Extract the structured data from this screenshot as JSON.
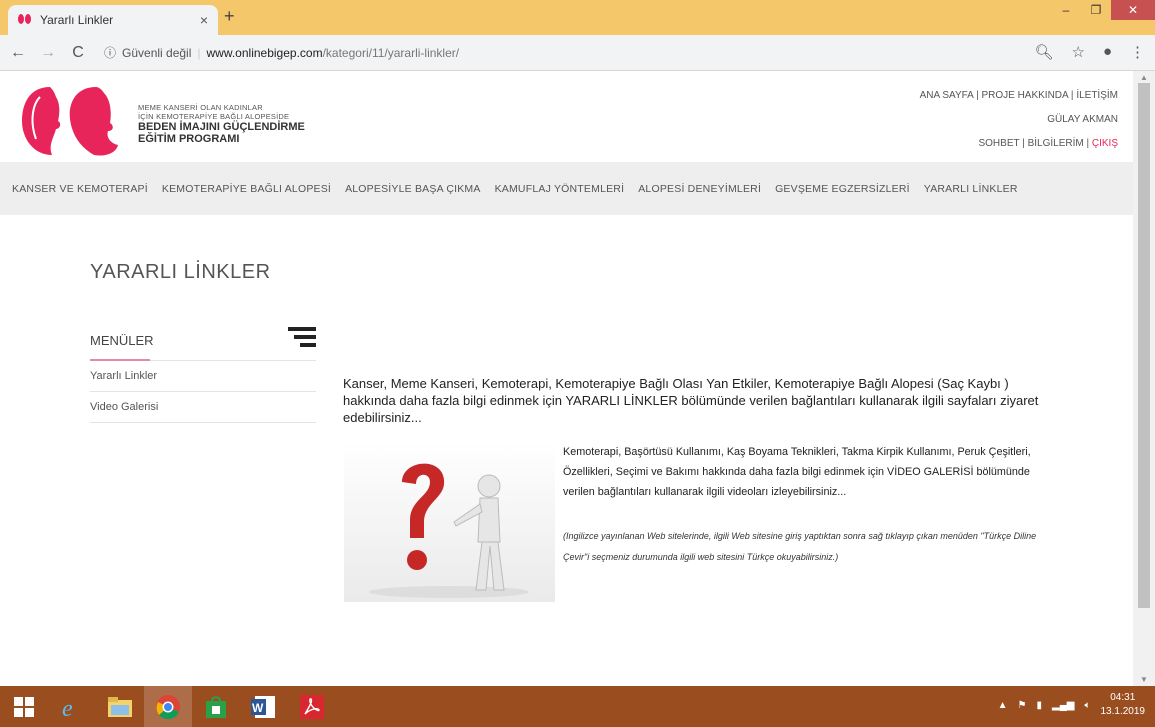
{
  "browser": {
    "tab_title": "Yararlı Linkler",
    "tab_close": "×",
    "new_tab": "+",
    "security_label": "Güvenli değil",
    "url_host": "www.onlinebigep.com",
    "url_path": "/kategori/11/yararli-linkler/",
    "window_minimize": "–",
    "window_restore": "❐",
    "window_close": "✕"
  },
  "header": {
    "logo_line1": "MEME KANSERİ OLAN KADINLAR",
    "logo_line2": "İÇİN KEMOTERAPİYE BAĞLI ALOPESİDE",
    "logo_line3": "BEDEN İMAJINI GÜÇLENDİRME",
    "logo_line4": "EĞİTİM PROGRAMI",
    "top_links": [
      "ANA SAYFA",
      "PROJE HAKKINDA",
      "İLETİŞİM"
    ],
    "user_name": "GÜLAY AKMAN",
    "user_links": [
      "SOHBET",
      "BİLGİLERİM"
    ],
    "logout": "ÇIKIŞ",
    "accent_color": "#e8255a"
  },
  "main_nav": [
    "KANSER VE KEMOTERAPİ",
    "KEMOTERAPİYE BAĞLI ALOPESİ",
    "ALOPESİYLE BAŞA ÇIKMA",
    "KAMUFLAJ YÖNTEMLERİ",
    "ALOPESİ DENEYİMLERİ",
    "GEVŞEME EGZERSİZLERİ",
    "YARARLI LİNKLER"
  ],
  "page": {
    "title": "YARARLI LİNKLER",
    "menu_heading": "MENÜLER",
    "menu_items": [
      "Yararlı Linkler",
      "Video Galerisi"
    ],
    "intro": "Kanser, Meme Kanseri, Kemoterapi, Kemoterapiye Bağlı Olası Yan Etkiler, Kemoterapiye Bağlı Alopesi (Saç Kaybı ) hakkında daha fazla bilgi edinmek için YARARLI LİNKLER bölümünde verilen bağlantıları kullanarak ilgili sayfaları ziyaret edebilirsiniz...",
    "description": "Kemoterapi, Başörtüsü Kullanımı, Kaş Boyama Teknikleri, Takma Kirpik Kullanımı, Peruk Çeşitleri, Özellikleri, Seçimi ve Bakımı hakkında daha fazla bilgi edinmek için VİDEO GALERİSİ bölümünde verilen bağlantıları kullanarak ilgili videoları izleyebilirsiniz...",
    "note": "(Ingilizce yayınlanan Web sitelerinde, ilgili Web sitesine giriş yaptıktan sonra sağ tıklayıp çıkan menüden \"Türkçe Diline Çevir\"i seçmeniz durumunda ilgili web sitesini Türkçe okuyabilirsiniz.)"
  },
  "taskbar": {
    "apps": [
      "windows-start-icon",
      "internet-explorer-icon",
      "file-explorer-icon",
      "chrome-icon",
      "store-icon",
      "word-icon",
      "acrobat-icon"
    ],
    "time": "04:31",
    "date": "13.1.2019"
  }
}
